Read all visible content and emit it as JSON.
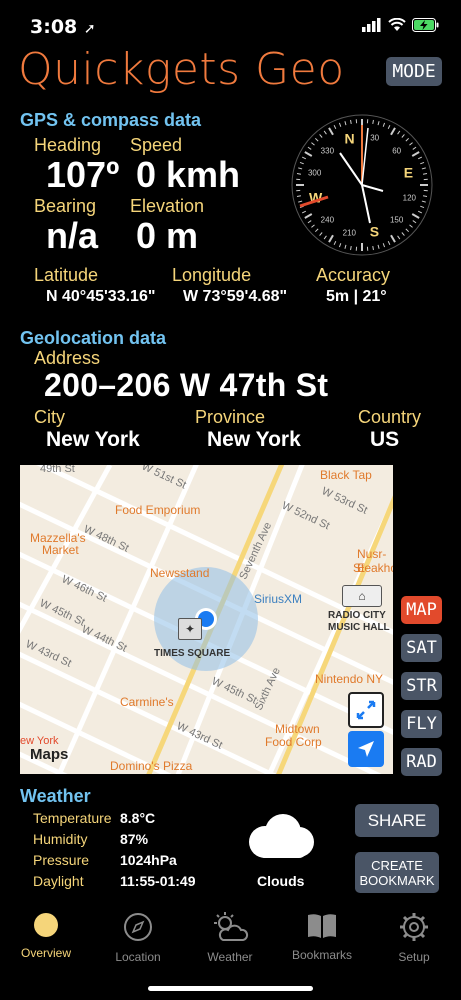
{
  "status": {
    "time": "3:08"
  },
  "app": {
    "title": "Quickgets Geo",
    "mode_label": "MODE"
  },
  "gps": {
    "section_title": "GPS & compass data",
    "heading_label": "Heading",
    "heading_value": "107º",
    "speed_label": "Speed",
    "speed_value": "0 kmh",
    "bearing_label": "Bearing",
    "bearing_value": "n/a",
    "elevation_label": "Elevation",
    "elevation_value": "0 m",
    "latitude_label": "Latitude",
    "latitude_value": "N 40°45'33.16\"",
    "longitude_label": "Longitude",
    "longitude_value": "W 73°59'4.68\"",
    "accuracy_label": "Accuracy",
    "accuracy_value": "5m | 21°"
  },
  "compass": {
    "letters": [
      "N",
      "E",
      "S",
      "W"
    ],
    "numbers": [
      "30",
      "60",
      "120",
      "150",
      "210",
      "240",
      "300",
      "330"
    ],
    "heading_deg": 107
  },
  "geo": {
    "section_title": "Geolocation data",
    "address_label": "Address",
    "address_value": "200–206 W 47th St",
    "city_label": "City",
    "city_value": "New York",
    "province_label": "Province",
    "province_value": "New York",
    "country_label": "Country",
    "country_value": "US"
  },
  "map": {
    "labels": {
      "w51": "W 51st St",
      "w53": "W 53rd St",
      "w52": "W 52nd St",
      "w48": "W 48th St",
      "w46": "W 46th St",
      "w45a": "W 45th St",
      "w44": "W 44th St",
      "w43": "W 43rd St",
      "w45b": "W 45th St",
      "w43b": "W 43rd St",
      "w49": "49th St",
      "seventh": "Seventh Ave",
      "sixth": "Sixth Ave",
      "blacktap": "Black Tap",
      "food_emporium": "Food Emporium",
      "mazzellas": "Mazzella's",
      "market": "Market",
      "newsstand": "Newsstand",
      "siriusxm": "SiriusXM",
      "nusr": "Nusr-E",
      "steakhouse": "Steakhou",
      "radio_city": "RADIO CITY",
      "music_hall": "MUSIC HALL",
      "times_square": "TIMES SQUARE",
      "nintendo": "Nintendo NY",
      "carmines": "Carmine's",
      "midtown": "Midtown",
      "comp": "Food Corp",
      "dominos": "Domino's Pizza",
      "newyork": "ew York",
      "maps": "Maps"
    },
    "buttons": [
      "MAP",
      "SAT",
      "STR",
      "FLY",
      "RAD"
    ],
    "active_button": "MAP"
  },
  "weather": {
    "section_title": "Weather",
    "temperature_label": "Temperature",
    "temperature_value": "8.8°C",
    "humidity_label": "Humidity",
    "humidity_value": "87%",
    "pressure_label": "Pressure",
    "pressure_value": "1024hPa",
    "daylight_label": "Daylight",
    "daylight_value": "11:55-01:49",
    "condition": "Clouds",
    "share_label": "SHARE",
    "bookmark_label_1": "CREATE",
    "bookmark_label_2": "BOOKMARK"
  },
  "tabs": {
    "overview": "Overview",
    "location": "Location",
    "weather": "Weather",
    "bookmarks": "Bookmarks",
    "setup": "Setup",
    "active": "overview"
  },
  "colors": {
    "accent_orange": "#f07a3e",
    "label_yellow": "#f5d57a",
    "section_blue": "#72c3f0",
    "button_grey": "#4a5566",
    "active_red": "#e24a2c"
  }
}
